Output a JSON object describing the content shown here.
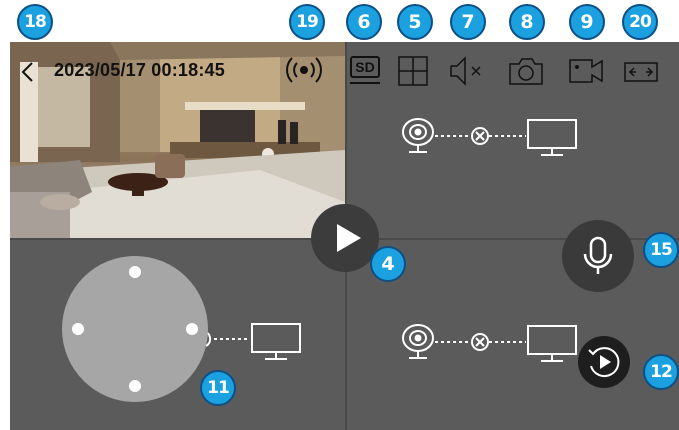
{
  "header": {
    "datetime": "2023/05/17 00:18:45"
  },
  "toolbar": {
    "sd_label": "SD"
  },
  "callouts": {
    "back": "18",
    "signal": "19",
    "sd": "6",
    "layout": "5",
    "mute": "7",
    "snapshot": "8",
    "record": "9",
    "fullscreen": "20",
    "play": "4",
    "ptz": "11",
    "talk": "15",
    "playback": "12"
  },
  "colors": {
    "callout_fill": "#1ba0e0",
    "callout_border": "#0d4f86",
    "panel_bg": "#5b5b5b"
  },
  "icons": {
    "back": "chevron-left-icon",
    "signal": "wireless-signal-icon",
    "layout": "grid-layout-icon",
    "mute": "speaker-muted-icon",
    "snapshot": "camera-icon",
    "record": "video-record-icon",
    "fullscreen": "expand-horizontal-icon",
    "play": "play-icon",
    "talk": "microphone-icon",
    "playback": "replay-icon",
    "connection": "camera-disconnected-monitor-icon"
  }
}
